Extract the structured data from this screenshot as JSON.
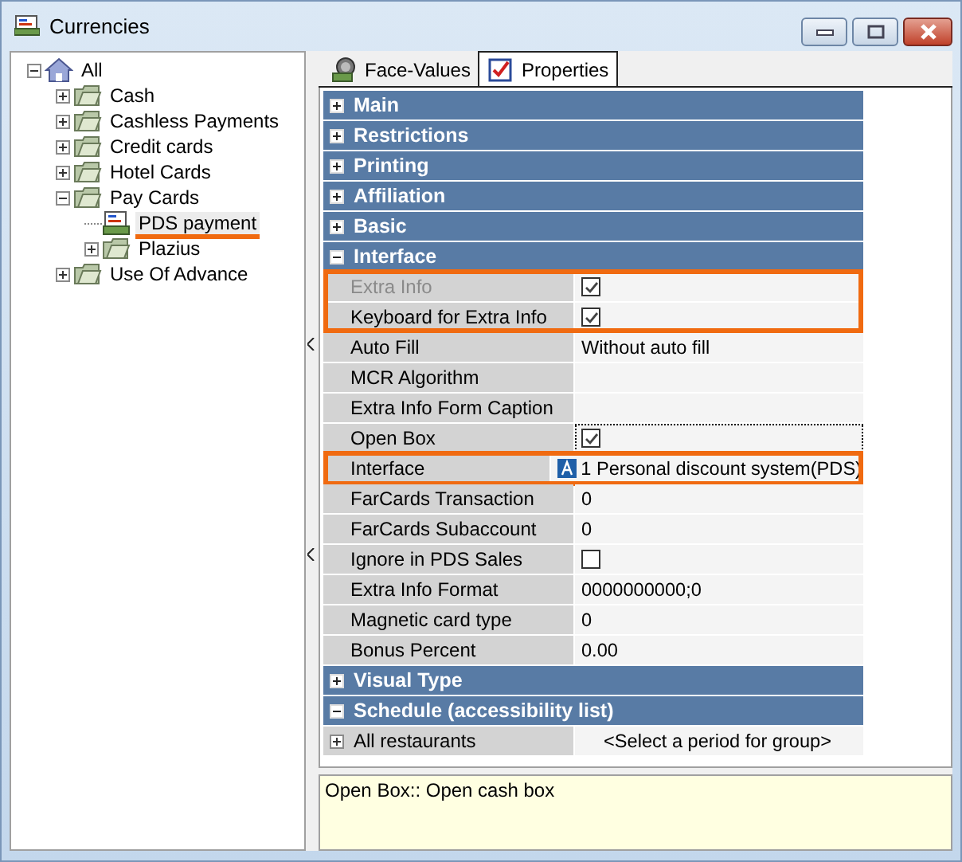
{
  "window": {
    "title": "Currencies"
  },
  "tree": {
    "label": "All",
    "kind": "root",
    "expanded": true,
    "selected": false,
    "highlighted": false,
    "children": [
      {
        "label": "Cash",
        "kind": "group",
        "expanded": false,
        "selected": false,
        "highlighted": false
      },
      {
        "label": "Cashless Payments",
        "kind": "group",
        "expanded": false,
        "selected": false,
        "highlighted": false
      },
      {
        "label": "Credit cards",
        "kind": "group",
        "expanded": false,
        "selected": false,
        "highlighted": false
      },
      {
        "label": "Hotel Cards",
        "kind": "group",
        "expanded": false,
        "selected": false,
        "highlighted": false
      },
      {
        "label": "Pay Cards",
        "kind": "group",
        "expanded": true,
        "selected": false,
        "highlighted": false,
        "children": [
          {
            "label": "PDS payment",
            "kind": "item",
            "selected": true,
            "highlighted": true
          },
          {
            "label": "Plazius",
            "kind": "group",
            "expanded": false,
            "selected": false,
            "highlighted": false
          }
        ]
      },
      {
        "label": "Use Of Advance",
        "kind": "group",
        "expanded": false,
        "selected": false,
        "highlighted": false
      }
    ]
  },
  "tabs": [
    {
      "label": "Face-Values",
      "kind": "coins",
      "selected": false
    },
    {
      "label": "Properties",
      "kind": "sheet",
      "selected": true
    }
  ],
  "sections": [
    {
      "title": "Main",
      "expanded": false
    },
    {
      "title": "Restrictions",
      "expanded": false
    },
    {
      "title": "Printing",
      "expanded": false
    },
    {
      "title": "Affiliation",
      "expanded": false
    },
    {
      "title": "Basic",
      "expanded": false
    },
    {
      "title": "Interface",
      "expanded": true,
      "rows": [
        {
          "label": "Extra Info",
          "kind": "check",
          "checked": true,
          "disabled": true,
          "highlighted": true,
          "focused": false
        },
        {
          "label": "Keyboard for Extra Info",
          "kind": "check",
          "checked": true,
          "disabled": false,
          "highlighted": true,
          "focused": false
        },
        {
          "label": "Auto Fill",
          "kind": "text",
          "value": "Without auto fill",
          "disabled": false,
          "highlighted": false,
          "focused": false
        },
        {
          "label": "MCR Algorithm",
          "kind": "text",
          "disabled": false,
          "highlighted": false,
          "focused": false
        },
        {
          "label": "Extra Info Form Caption",
          "kind": "text",
          "disabled": false,
          "highlighted": false,
          "focused": false
        },
        {
          "label": "Open Box",
          "kind": "check",
          "checked": true,
          "disabled": false,
          "highlighted": false,
          "focused": true
        },
        {
          "label": "Interface",
          "kind": "ref",
          "value": "1 Personal discount system(PDS)",
          "disabled": false,
          "highlighted": true,
          "focused": false
        },
        {
          "label": "FarCards Transaction",
          "kind": "text",
          "value": "0",
          "disabled": false,
          "highlighted": false,
          "focused": false
        },
        {
          "label": "FarCards Subaccount",
          "kind": "text",
          "value": "0",
          "disabled": false,
          "highlighted": false,
          "focused": false
        },
        {
          "label": "Ignore in PDS Sales",
          "kind": "check",
          "checked": false,
          "disabled": false,
          "highlighted": false,
          "focused": false
        },
        {
          "label": "Extra Info Format",
          "kind": "text",
          "value": "0000000000;0",
          "disabled": false,
          "highlighted": false,
          "focused": false
        },
        {
          "label": "Magnetic card type",
          "kind": "text",
          "value": "0",
          "disabled": false,
          "highlighted": false,
          "focused": false
        },
        {
          "label": "Bonus Percent",
          "kind": "text",
          "value": "0.00",
          "disabled": false,
          "highlighted": false,
          "focused": false
        }
      ]
    },
    {
      "title": "Visual Type",
      "expanded": false
    },
    {
      "title": "Schedule (accessibility list)",
      "expanded": true,
      "rows": [
        {
          "label": "All restaurants",
          "kind": "group",
          "expanded": false,
          "value": "<Select a period for group>",
          "disabled": false,
          "highlighted": false,
          "focused": false
        }
      ]
    }
  ],
  "description": "Open Box:: Open cash box"
}
